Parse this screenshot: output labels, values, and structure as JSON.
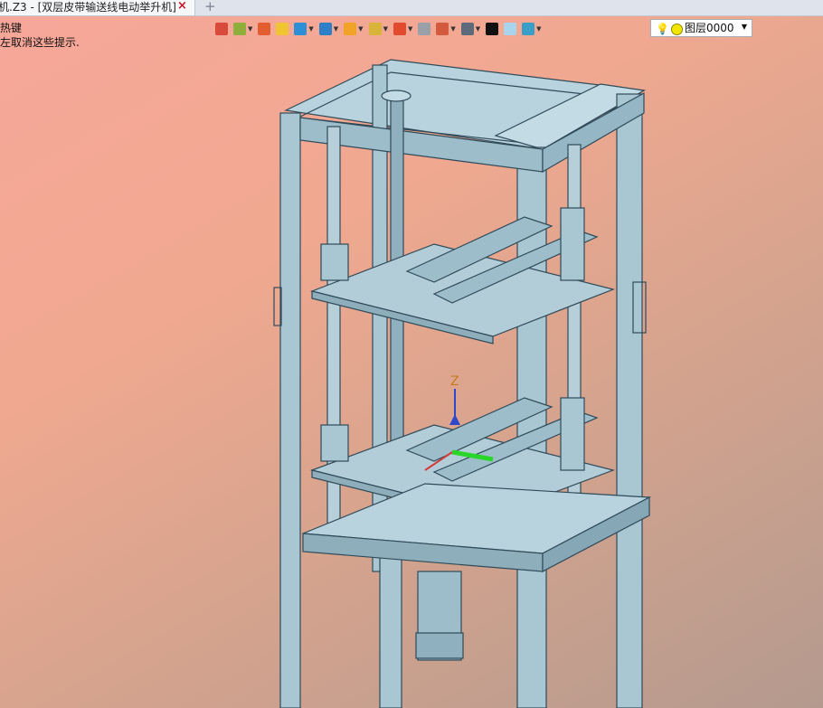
{
  "tab": {
    "title": "机.Z3 - [双层皮带输送线电动举升机]",
    "close_icon": "×",
    "new_tab_icon": "+"
  },
  "hints": [
    "热键",
    "左取消这些提示."
  ],
  "toolbar": {
    "tools": [
      {
        "name": "exit-sketch-icon",
        "color": "#d84a3a",
        "dropdown": false
      },
      {
        "name": "paint-bucket-icon",
        "color": "#8fae3c",
        "dropdown": true
      },
      {
        "name": "pencil-icon",
        "color": "#e25d2f",
        "dropdown": false
      },
      {
        "name": "box-face-icon",
        "color": "#f1c431",
        "dropdown": false
      },
      {
        "name": "solid-cube-icon",
        "color": "#2d8fd6",
        "dropdown": true
      },
      {
        "name": "view-cube-icon",
        "color": "#2d7fc7",
        "dropdown": true
      },
      {
        "name": "orient-wheel-icon",
        "color": "#f0a327",
        "dropdown": true
      },
      {
        "name": "zoom-window-icon",
        "color": "#d9b43a",
        "dropdown": true
      },
      {
        "name": "target-icon",
        "color": "#e04a2d",
        "dropdown": true
      },
      {
        "name": "page-icon",
        "color": "#9aa0a8",
        "dropdown": false
      },
      {
        "name": "dimension-icon",
        "color": "#d35a3c",
        "dropdown": true
      },
      {
        "name": "monitor-icon",
        "color": "#5c6a7a",
        "dropdown": true
      },
      {
        "name": "line-width-icon",
        "color": "#111111",
        "dropdown": false
      },
      {
        "name": "color-swatch-icon",
        "color": "#a9d5ec",
        "dropdown": false
      },
      {
        "name": "layers-icon",
        "color": "#3a9ec9",
        "dropdown": true
      }
    ]
  },
  "layer": {
    "bulb": "💡",
    "name": "图层0000",
    "arrow": "▼"
  },
  "model": {
    "axis_label": "Z",
    "metal_color": "#a9c6d3",
    "edge_color": "#2f4a59"
  }
}
